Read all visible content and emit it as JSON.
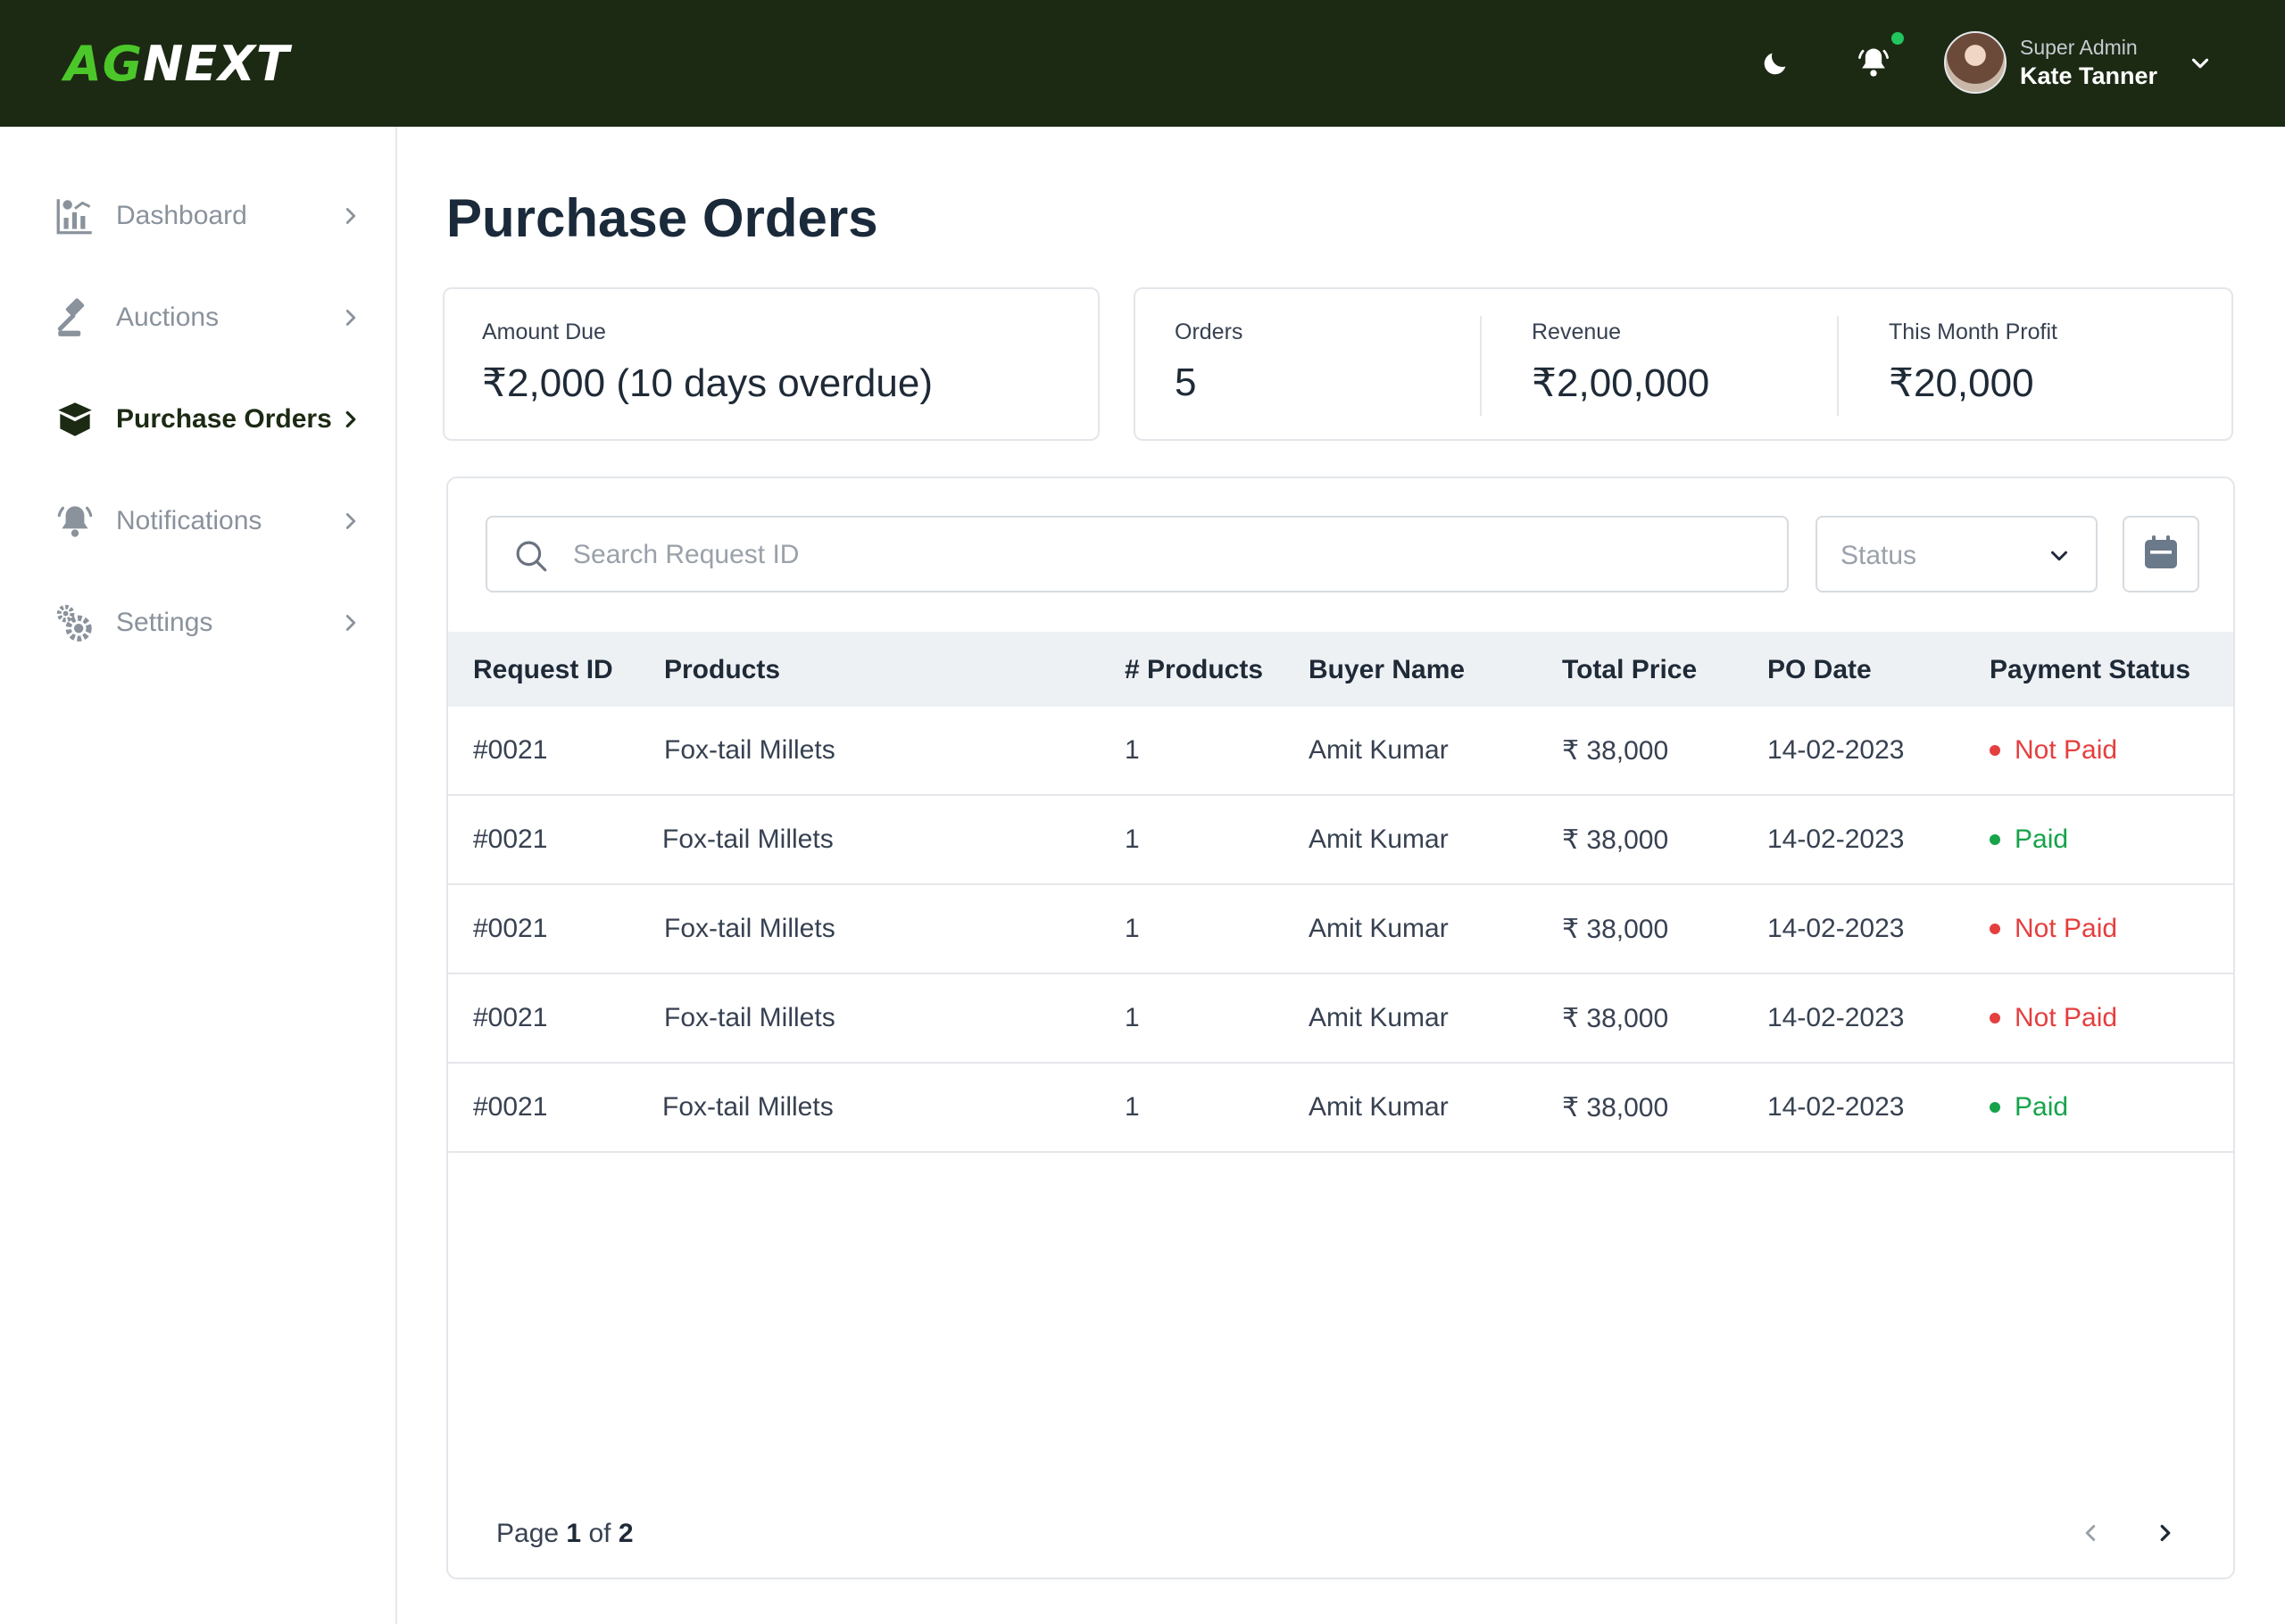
{
  "brand": {
    "logo_part1": "AG",
    "logo_part2": "NEXT",
    "accent": "#4cc72a",
    "topbar_color": "#1c2a14"
  },
  "header": {
    "user_role": "Super Admin",
    "user_name": "Kate Tanner",
    "icons": [
      "moon-icon",
      "bell-icon",
      "chevron-down-icon"
    ]
  },
  "sidebar": {
    "items": [
      {
        "label": "Dashboard",
        "icon": "chart-icon",
        "active": false
      },
      {
        "label": "Auctions",
        "icon": "gavel-icon",
        "active": false
      },
      {
        "label": "Purchase Orders",
        "icon": "box-icon",
        "active": true
      },
      {
        "label": "Notifications",
        "icon": "bell-icon",
        "active": false
      },
      {
        "label": "Settings",
        "icon": "gear-icon",
        "active": false
      }
    ]
  },
  "page": {
    "title": "Purchase Orders"
  },
  "summary": {
    "amount_due_label": "Amount Due",
    "amount_due_value": "₹2,000 (10 days overdue)",
    "orders_label": "Orders",
    "orders_value": "5",
    "revenue_label": "Revenue",
    "revenue_value": "₹2,00,000",
    "profit_label": "This Month Profit",
    "profit_value": "₹20,000"
  },
  "filters": {
    "search_placeholder": "Search Request ID",
    "status_label": "Status"
  },
  "table": {
    "headers": {
      "request_id": "Request ID",
      "products": "Products",
      "num_products": "# Products",
      "buyer": "Buyer Name",
      "total": "Total Price",
      "po_date": "PO Date",
      "payment": "Payment Status"
    },
    "rows": [
      {
        "request_id": "#0021",
        "products": "Fox-tail Millets",
        "num_products": "1",
        "buyer": "Amit Kumar",
        "total": "₹ 38,000",
        "po_date": "14-02-2023",
        "payment": "Not Paid"
      },
      {
        "request_id": "#0021",
        "products": "Fox-tail Millets",
        "num_products": "1",
        "buyer": "Amit Kumar",
        "total": "₹ 38,000",
        "po_date": "14-02-2023",
        "payment": "Paid"
      },
      {
        "request_id": "#0021",
        "products": "Fox-tail Millets",
        "num_products": "1",
        "buyer": "Amit Kumar",
        "total": "₹ 38,000",
        "po_date": "14-02-2023",
        "payment": "Not Paid"
      },
      {
        "request_id": "#0021",
        "products": "Fox-tail Millets",
        "num_products": "1",
        "buyer": "Amit Kumar",
        "total": "₹ 38,000",
        "po_date": "14-02-2023",
        "payment": "Not Paid"
      },
      {
        "request_id": "#0021",
        "products": "Fox-tail Millets",
        "num_products": "1",
        "buyer": "Amit Kumar",
        "total": "₹ 38,000",
        "po_date": "14-02-2023",
        "payment": "Paid"
      }
    ],
    "status_colors": {
      "not_paid": "#e53e3e",
      "paid": "#16a34a"
    }
  },
  "pagination": {
    "prefix": "Page",
    "current": "1",
    "separator": "of",
    "total": "2"
  }
}
